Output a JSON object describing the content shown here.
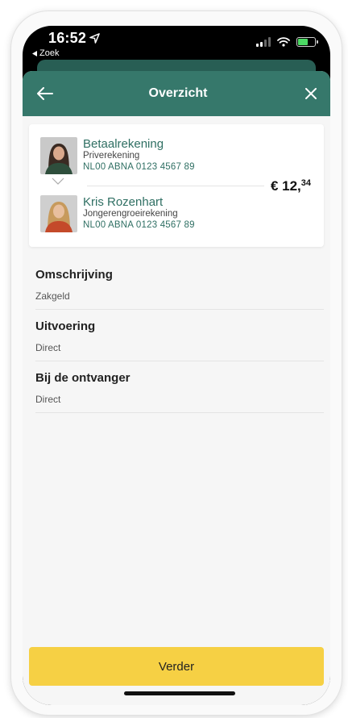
{
  "status_bar": {
    "time": "16:52",
    "back_app": "Zoek",
    "battery_color": "#4cd964"
  },
  "nav": {
    "title": "Overzicht",
    "back_icon": "arrow-left-icon",
    "close_icon": "close-icon",
    "color": "#36786b"
  },
  "transfer": {
    "from": {
      "name": "Betaalrekening",
      "type": "Priverekening",
      "iban": "NL00 ABNA 0123 4567 89"
    },
    "to": {
      "name": "Kris Rozenhart",
      "type": "Jongerengroeirekening",
      "iban": "NL00 ABNA 0123 4567 89"
    },
    "amount_main": "€ 12,",
    "amount_cents": "34"
  },
  "details": [
    {
      "label": "Omschrijving",
      "value": "Zakgeld"
    },
    {
      "label": "Uitvoering",
      "value": "Direct"
    },
    {
      "label": "Bij de ontvanger",
      "value": "Direct"
    }
  ],
  "actions": {
    "next_label": "Verder",
    "next_color": "#f6d044"
  }
}
